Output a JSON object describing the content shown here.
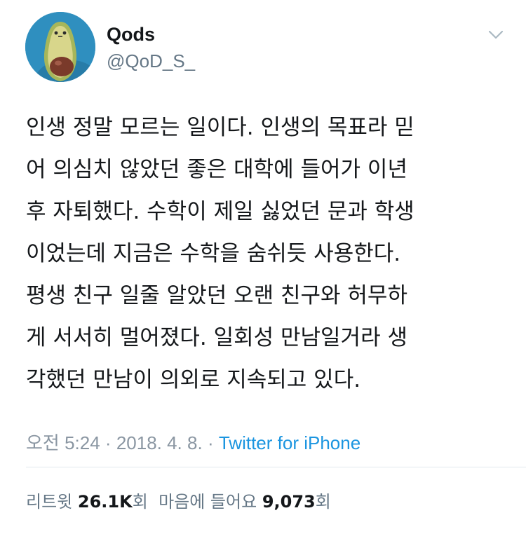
{
  "user": {
    "name": "Qods",
    "handle": "@QoD_S_"
  },
  "tweet": {
    "lines": [
      "인생 정말 모르는 일이다. 인생의 목표라 믿",
      "어 의심치 않았던 좋은 대학에 들어가 이년",
      "후 자퇴했다. 수학이 제일 싫었던 문과 학생",
      "이었는데 지금은 수학을 숨쉬듯 사용한다.",
      "평생 친구 일줄 알았던 오랜 친구와 허무하",
      "게 서서히 멀어졌다. 일회성 만남일거라 생",
      "각했던 만남이 의외로 지속되고 있다."
    ]
  },
  "meta": {
    "time": "오전 5:24",
    "separator": "·",
    "date": "2018. 4. 8.",
    "source": "Twitter for iPhone"
  },
  "stats": {
    "retweet_label": "리트윗",
    "retweet_count": "26.1K",
    "retweet_unit": "회",
    "like_label": "마음에 들어요",
    "like_count": "9,073",
    "like_unit": "회"
  },
  "colors": {
    "link": "#1b95e0",
    "secondary_text": "#657786",
    "avatar_background": "#2f8fbf"
  }
}
